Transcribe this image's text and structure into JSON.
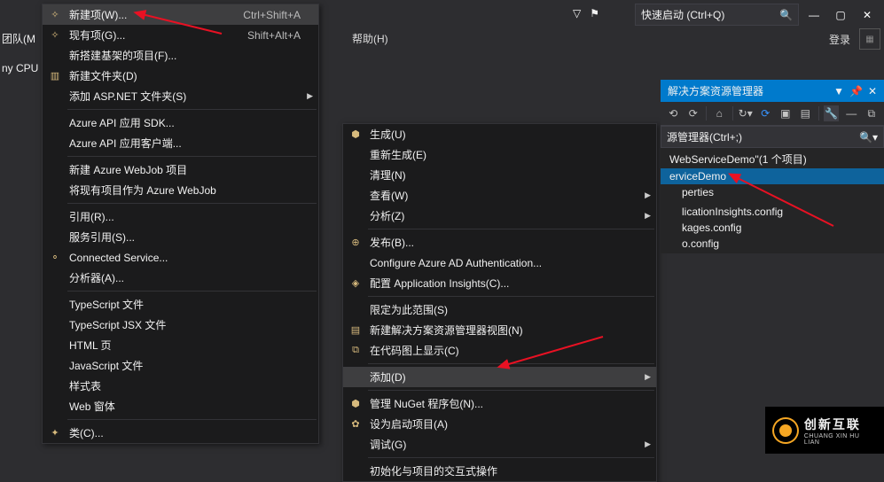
{
  "topbar": {
    "quick_launch_ph": "快速启动 (Ctrl+Q)",
    "login": "登录"
  },
  "help": "帮助(H)",
  "left": {
    "team": "团队(M",
    "cpu": "ny CPU"
  },
  "cascade1": {
    "groups": [
      [
        {
          "icon": "✧",
          "label": "新建项(W)...",
          "shortcut": "Ctrl+Shift+A",
          "hl": true
        },
        {
          "icon": "✧",
          "label": "现有项(G)...",
          "shortcut": "Shift+Alt+A"
        },
        {
          "icon": "",
          "label": "新搭建基架的项目(F)..."
        },
        {
          "icon": "▥",
          "label": "新建文件夹(D)"
        },
        {
          "icon": "",
          "label": "添加 ASP.NET 文件夹(S)",
          "sub": true
        }
      ],
      [
        {
          "label": "Azure API 应用 SDK..."
        },
        {
          "label": "Azure API 应用客户端..."
        }
      ],
      [
        {
          "label": "新建 Azure WebJob 项目"
        },
        {
          "label": "将现有项目作为 Azure WebJob"
        }
      ],
      [
        {
          "label": "引用(R)..."
        },
        {
          "label": "服务引用(S)..."
        },
        {
          "icon": "⚬",
          "label": "Connected Service..."
        },
        {
          "label": "分析器(A)..."
        }
      ],
      [
        {
          "label": "TypeScript 文件"
        },
        {
          "label": "TypeScript JSX 文件"
        },
        {
          "label": "HTML 页"
        },
        {
          "label": "JavaScript 文件"
        },
        {
          "label": "样式表"
        },
        {
          "label": "Web 窗体"
        }
      ],
      [
        {
          "icon": "✦",
          "label": "类(C)..."
        }
      ]
    ]
  },
  "cascade2": {
    "groups": [
      [
        {
          "icon": "⬢",
          "label": "生成(U)"
        },
        {
          "label": "重新生成(E)"
        },
        {
          "label": "清理(N)"
        },
        {
          "label": "查看(W)",
          "sub": true
        },
        {
          "label": "分析(Z)",
          "sub": true
        }
      ],
      [
        {
          "icon": "⊕",
          "label": "发布(B)..."
        },
        {
          "label": "Configure Azure AD Authentication..."
        },
        {
          "icon": "◈",
          "label": "配置 Application Insights(C)..."
        }
      ],
      [
        {
          "label": "限定为此范围(S)"
        },
        {
          "icon": "▤",
          "label": "新建解决方案资源管理器视图(N)"
        },
        {
          "icon": "⧉",
          "label": "在代码图上显示(C)"
        }
      ],
      [
        {
          "label": "添加(D)",
          "sub": true,
          "hl": true
        }
      ],
      [
        {
          "icon": "⬢",
          "label": "管理 NuGet 程序包(N)..."
        },
        {
          "icon": "✿",
          "label": "设为启动项目(A)"
        },
        {
          "label": "调试(G)",
          "sub": true
        }
      ],
      [
        {
          "label": "初始化与项目的交互式操作"
        }
      ]
    ]
  },
  "solution": {
    "title": "解决方案资源管理器",
    "search_ph": "源管理器(Ctrl+;)",
    "tree": [
      {
        "d": 0,
        "label": "WebServiceDemo\"(1 个项目)"
      },
      {
        "d": 0,
        "label": "erviceDemo",
        "sel": true
      },
      {
        "d": 1,
        "label": "perties"
      },
      {
        "d": 1,
        "label": ""
      },
      {
        "d": 1,
        "label": "licationInsights.config"
      },
      {
        "d": 1,
        "label": "kages.config"
      },
      {
        "d": 1,
        "label": "o.config"
      }
    ]
  },
  "brand": {
    "cn": "创新互联",
    "py": "CHUANG XIN HU LIAN"
  }
}
